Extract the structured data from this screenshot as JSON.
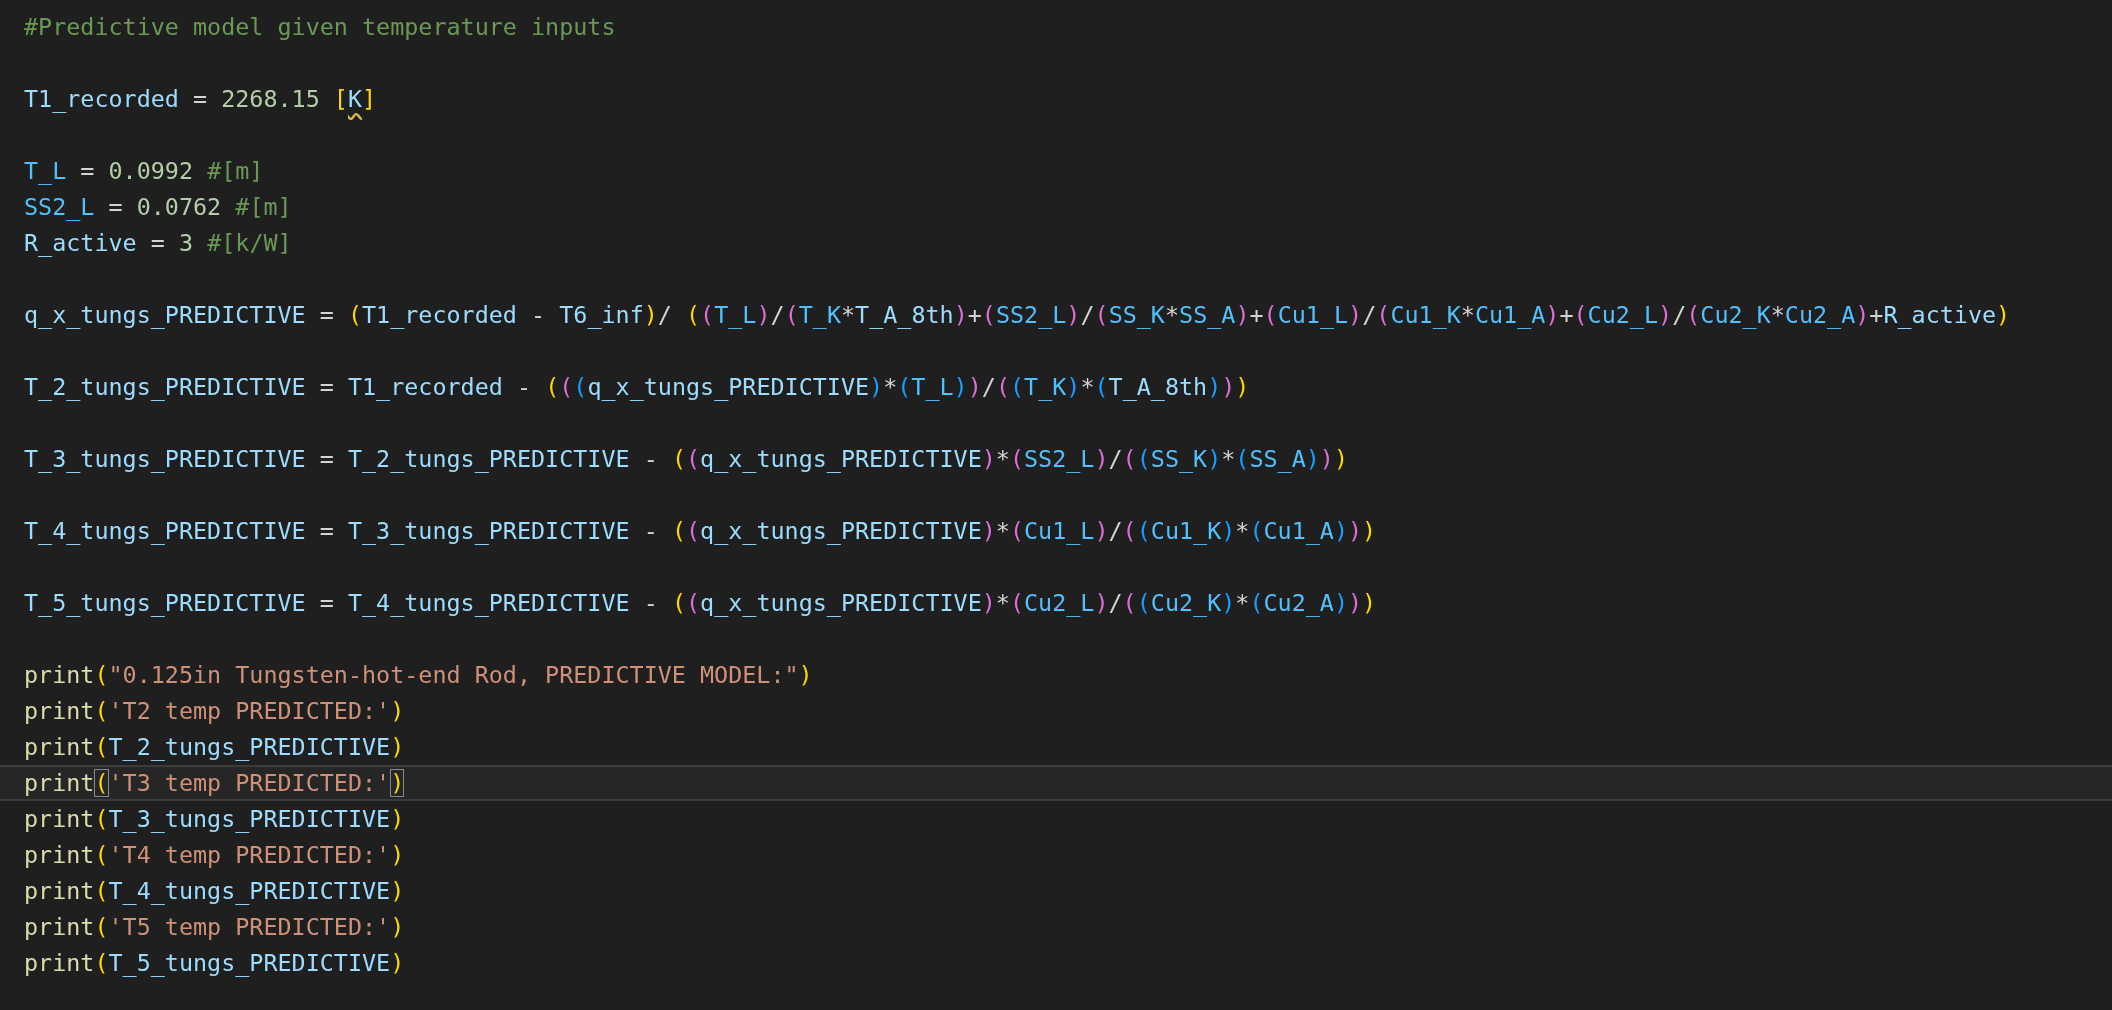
{
  "editor": {
    "blocks": [
      [
        {
          "text": "#Predictive model given temperature inputs",
          "current": false,
          "warning": false
        }
      ],
      [
        {
          "text": "T1_recorded = 2268.15 [K]",
          "current": false,
          "warning": true
        }
      ],
      [
        {
          "text": "T_L = 0.0992 #[m]",
          "current": false,
          "warning": false
        },
        {
          "text": "SS2_L = 0.0762 #[m]",
          "current": false,
          "warning": false
        },
        {
          "text": "R_active = 3 #[k/W]",
          "current": false,
          "warning": false
        }
      ],
      [
        {
          "text": "q_x_tungs_PREDICTIVE = (T1_recorded - T6_inf)/ ((T_L)/(T_K*T_A_8th)+(SS2_L)/(SS_K*SS_A)+(Cu1_L)/(Cu1_K*Cu1_A)+(Cu2_L)/(Cu2_K*Cu2_A)+R_active)",
          "current": false,
          "warning": false
        }
      ],
      [
        {
          "text": "T_2_tungs_PREDICTIVE = T1_recorded - (((q_x_tungs_PREDICTIVE)*(T_L))/((T_K)*(T_A_8th)))",
          "current": false,
          "warning": false
        }
      ],
      [
        {
          "text": "T_3_tungs_PREDICTIVE = T_2_tungs_PREDICTIVE - ((q_x_tungs_PREDICTIVE)*(SS2_L)/((SS_K)*(SS_A)))",
          "current": false,
          "warning": false
        }
      ],
      [
        {
          "text": "T_4_tungs_PREDICTIVE = T_3_tungs_PREDICTIVE - ((q_x_tungs_PREDICTIVE)*(Cu1_L)/((Cu1_K)*(Cu1_A)))",
          "current": false,
          "warning": false
        }
      ],
      [
        {
          "text": "T_5_tungs_PREDICTIVE = T_4_tungs_PREDICTIVE - ((q_x_tungs_PREDICTIVE)*(Cu2_L)/((Cu2_K)*(Cu2_A)))",
          "current": false,
          "warning": false
        }
      ],
      [
        {
          "text": "print(\"0.125in Tungsten-hot-end Rod, PREDICTIVE MODEL:\")",
          "current": false,
          "warning": false
        },
        {
          "text": "print('T2 temp PREDICTED:')",
          "current": false,
          "warning": false
        },
        {
          "text": "print(T_2_tungs_PREDICTIVE)",
          "current": false,
          "warning": false
        },
        {
          "text": "print('T3 temp PREDICTED:')",
          "current": true,
          "warning": false
        },
        {
          "text": "print(T_3_tungs_PREDICTIVE)",
          "current": false,
          "warning": false
        },
        {
          "text": "print('T4 temp PREDICTED:')",
          "current": false,
          "warning": false
        },
        {
          "text": "print(T_4_tungs_PREDICTIVE)",
          "current": false,
          "warning": false
        },
        {
          "text": "print('T5 temp PREDICTED:')",
          "current": false,
          "warning": false
        },
        {
          "text": "print(T_5_tungs_PREDICTIVE)",
          "current": false,
          "warning": false
        }
      ]
    ]
  }
}
